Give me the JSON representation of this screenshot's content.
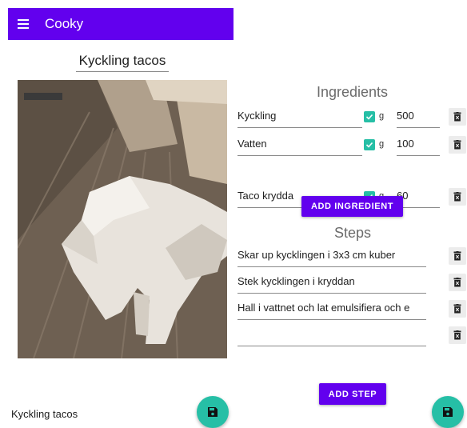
{
  "app_bar": {
    "title": "Cooky",
    "menu_icon": "menu-icon"
  },
  "recipe": {
    "title": "Kyckling tacos",
    "image": "low-poly dog in wooden room"
  },
  "ingredients": {
    "heading": "Ingredients",
    "items": [
      {
        "name": "Kyckling",
        "checked": true,
        "unit": "g",
        "amount": "500"
      },
      {
        "name": "Vatten",
        "checked": true,
        "unit": "g",
        "amount": "100"
      },
      {
        "name": "Taco krydda",
        "checked": true,
        "unit": "g",
        "amount": "60"
      }
    ],
    "add_label": "ADD INGREDIENT"
  },
  "steps": {
    "heading": "Steps",
    "items": [
      {
        "text": "Skar up kycklingen i 3x3 cm kuber"
      },
      {
        "text": "Stek kycklingen i kryddan"
      },
      {
        "text": "Hall i vattnet och lat emulsifiera och e"
      },
      {
        "text": ""
      }
    ],
    "add_label": "ADD STEP"
  },
  "footer": {
    "label": "Kyckling tacos"
  },
  "colors": {
    "primary": "#6200ee",
    "accent": "#26bfa6"
  }
}
